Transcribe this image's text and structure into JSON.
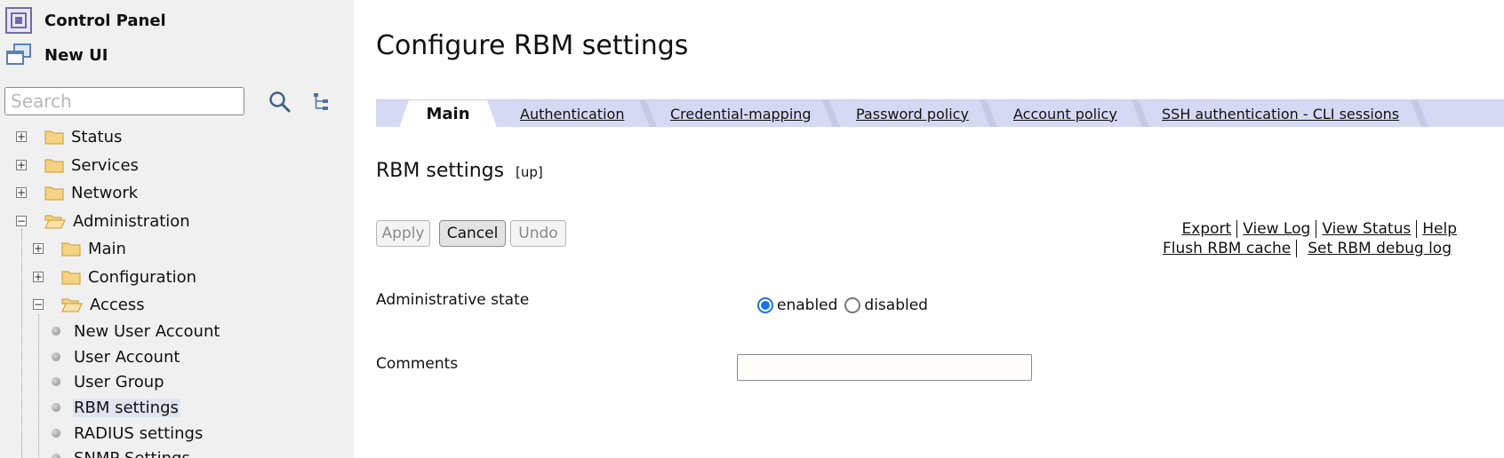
{
  "sidebar": {
    "control_panel_label": "Control Panel",
    "new_ui_label": "New UI",
    "search": {
      "placeholder": "Search",
      "value": ""
    },
    "tree": {
      "status": "Status",
      "services": "Services",
      "network": "Network",
      "administration": "Administration",
      "main": "Main",
      "configuration": "Configuration",
      "access": "Access",
      "leaves": {
        "new_user_account": "New User Account",
        "user_account": "User Account",
        "user_group": "User Group",
        "rbm_settings": "RBM settings",
        "radius_settings": "RADIUS settings",
        "snmp_settings": "SNMP Settings"
      }
    },
    "expanders": {
      "collapsed": "+",
      "expanded": "−"
    }
  },
  "main": {
    "title": "Configure RBM settings",
    "tabs": {
      "main": "Main",
      "authentication": "Authentication",
      "credential_mapping": "Credential-mapping",
      "password_policy": "Password policy",
      "account_policy": "Account policy",
      "ssh_authentication": "SSH authentication - CLI sessions"
    },
    "section_title": "RBM settings",
    "up_link": "[up]",
    "buttons": {
      "apply": "Apply",
      "cancel": "Cancel",
      "undo": "Undo"
    },
    "links": {
      "export": "Export",
      "view_log": "View Log",
      "view_status": "View Status",
      "help": "Help",
      "flush_cache": "Flush RBM cache",
      "set_debug_log": "Set RBM debug log"
    },
    "fields": {
      "admin_state": {
        "label": "Administrative state",
        "options": {
          "enabled": "enabled",
          "disabled": "disabled"
        },
        "selected": "enabled"
      },
      "comments": {
        "label": "Comments",
        "value": ""
      }
    }
  },
  "colors": {
    "sidebar_bg": "#f0f0f0",
    "tab_bar_bg": "#d5d9f3",
    "radio_accent": "#1a73e8",
    "folder": "#f2c769"
  }
}
